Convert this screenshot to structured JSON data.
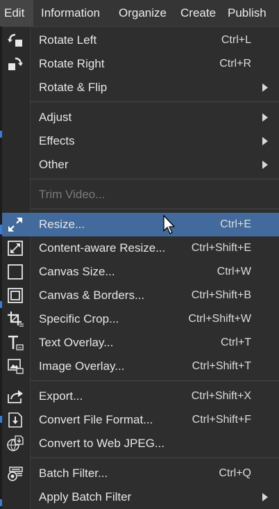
{
  "menubar": {
    "edit": "Edit",
    "information": "Information",
    "organize": "Organize",
    "create": "Create",
    "publish": "Publish"
  },
  "menu": {
    "rotate_left": {
      "label": "Rotate Left",
      "shortcut": "Ctrl+L",
      "icon": "rotate-left-icon"
    },
    "rotate_right": {
      "label": "Rotate Right",
      "shortcut": "Ctrl+R",
      "icon": "rotate-right-icon"
    },
    "rotate_flip": {
      "label": "Rotate & Flip"
    },
    "adjust": {
      "label": "Adjust"
    },
    "effects": {
      "label": "Effects"
    },
    "other": {
      "label": "Other"
    },
    "trim_video": {
      "label": "Trim Video..."
    },
    "resize": {
      "label": "Resize...",
      "shortcut": "Ctrl+E",
      "icon": "resize-icon"
    },
    "content_aware_resize": {
      "label": "Content-aware Resize...",
      "shortcut": "Ctrl+Shift+E",
      "icon": "content-aware-resize-icon"
    },
    "canvas_size": {
      "label": "Canvas Size...",
      "shortcut": "Ctrl+W",
      "icon": "canvas-size-icon"
    },
    "canvas_borders": {
      "label": "Canvas & Borders...",
      "shortcut": "Ctrl+Shift+B",
      "icon": "canvas-borders-icon"
    },
    "specific_crop": {
      "label": "Specific Crop...",
      "shortcut": "Ctrl+Shift+W",
      "icon": "crop-icon"
    },
    "text_overlay": {
      "label": "Text Overlay...",
      "shortcut": "Ctrl+T",
      "icon": "text-overlay-icon"
    },
    "image_overlay": {
      "label": "Image Overlay...",
      "shortcut": "Ctrl+Shift+T",
      "icon": "image-overlay-icon"
    },
    "export": {
      "label": "Export...",
      "shortcut": "Ctrl+Shift+X",
      "icon": "export-icon"
    },
    "convert_file_format": {
      "label": "Convert File Format...",
      "shortcut": "Ctrl+Shift+F",
      "icon": "convert-format-icon"
    },
    "convert_web_jpeg": {
      "label": "Convert to Web JPEG...",
      "icon": "web-jpeg-icon"
    },
    "batch_filter": {
      "label": "Batch Filter...",
      "shortcut": "Ctrl+Q",
      "icon": "batch-filter-icon"
    },
    "apply_batch_filter": {
      "label": "Apply Batch Filter"
    }
  },
  "colors": {
    "highlight": "#436a9c",
    "background": "#2e2e2e",
    "disabled_text": "#7a7a7a"
  }
}
